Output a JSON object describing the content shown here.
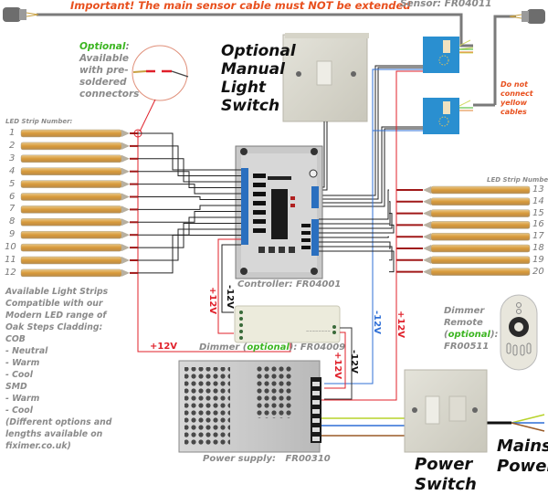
{
  "header": {
    "warning": "Important! The main sensor cable  must NOT be extended",
    "sensor_label": "Sensor: FR04011"
  },
  "optional_note": {
    "heading": "Optional",
    "colon": ":",
    "lines": [
      "Available",
      "with pre-",
      "soldered",
      "connectors"
    ]
  },
  "manual_switch": {
    "lines": [
      "Optional",
      "Manual",
      "Light",
      "Switch"
    ]
  },
  "sensor_warning": {
    "lines": [
      "Do not",
      "connect",
      "yellow",
      "cables"
    ]
  },
  "led_strips": {
    "left_heading": "LED Strip Number:",
    "right_heading": "LED Strip Number:",
    "left_numbers": [
      "1",
      "2",
      "3",
      "4",
      "5",
      "6",
      "7",
      "8",
      "9",
      "10",
      "11",
      "12"
    ],
    "right_numbers": [
      "13",
      "14",
      "15",
      "16",
      "17",
      "18",
      "19",
      "20"
    ]
  },
  "controller": {
    "label": "Controller: FR04001"
  },
  "dimmer": {
    "prefix": "Dimmer (",
    "optional": "optional",
    "suffix": "): FR04009"
  },
  "dimmer_remote": {
    "line1": "Dimmer",
    "line2": "Remote",
    "optional_open": "(",
    "optional": "optional",
    "optional_close": "):",
    "code": "FR00511"
  },
  "power_supply": {
    "label": "Power supply:   FR00310"
  },
  "power_switch": {
    "lines": [
      "Power",
      "Switch"
    ]
  },
  "mains_power": {
    "lines": [
      "Mains",
      "Power"
    ]
  },
  "voltage_labels": {
    "plus12": "+12V",
    "minus12": "-12V"
  },
  "strips_info": {
    "lines": [
      "Available Light Strips",
      "Compatible with our",
      "Modern LED range of",
      "Oak Steps Cladding:",
      "COB",
      "- Neutral",
      "- Warm",
      "- Cool",
      "SMD",
      "- Warm",
      "- Cool",
      "(Different options and",
      "lengths available on",
      "fiximer.co.uk)"
    ]
  },
  "colors": {
    "warning_orange": "#e8501e",
    "optional_green": "#3cb521",
    "wire_red": "#e0202a",
    "wire_blue": "#2f6fd6",
    "wire_black": "#222222",
    "sensor_cable_grey": "#777777",
    "earth_yellow_green": "#b7d32a",
    "neutral_blue": "#2f6fd6",
    "live_brown": "#9a5a26",
    "sensor_blue": "#2a8fd0"
  }
}
